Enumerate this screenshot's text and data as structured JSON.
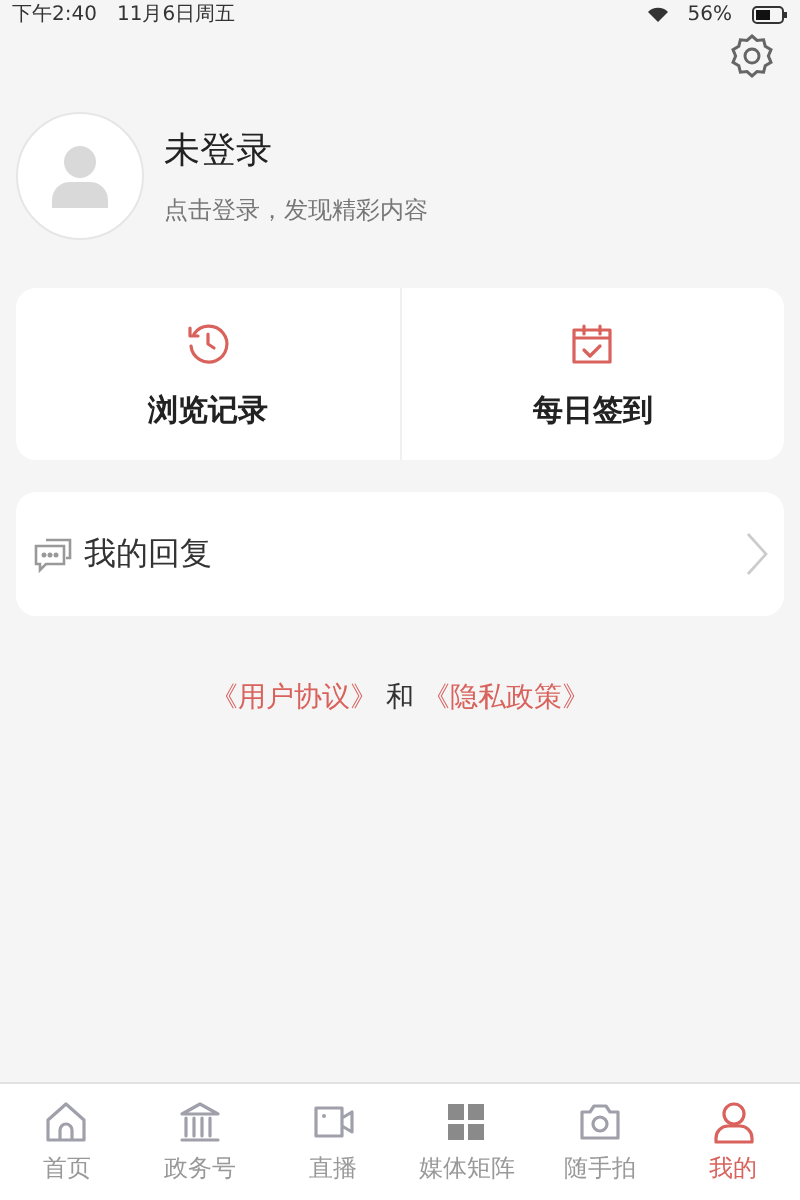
{
  "status_bar": {
    "time": "下午2:40",
    "date": "11月6日周五",
    "battery": "56%"
  },
  "profile": {
    "name": "未登录",
    "subtitle": "点击登录，发现精彩内容"
  },
  "shortcuts": [
    {
      "kind": "history",
      "label": "浏览记录"
    },
    {
      "kind": "calendar",
      "label": "每日签到"
    }
  ],
  "menu": [
    {
      "kind": "comments",
      "label": "我的回复"
    }
  ],
  "legal": {
    "user_agreement": "《用户协议》",
    "joiner": "和",
    "privacy_policy": "《隐私政策》"
  },
  "tab_bar": [
    {
      "kind": "home",
      "label": "首页",
      "selected": false
    },
    {
      "kind": "bank",
      "label": "政务号",
      "selected": false
    },
    {
      "kind": "video",
      "label": "直播",
      "selected": false
    },
    {
      "kind": "grid",
      "label": "媒体矩阵",
      "selected": false
    },
    {
      "kind": "camera",
      "label": "随手拍",
      "selected": false
    },
    {
      "kind": "user",
      "label": "我的",
      "selected": true
    }
  ]
}
